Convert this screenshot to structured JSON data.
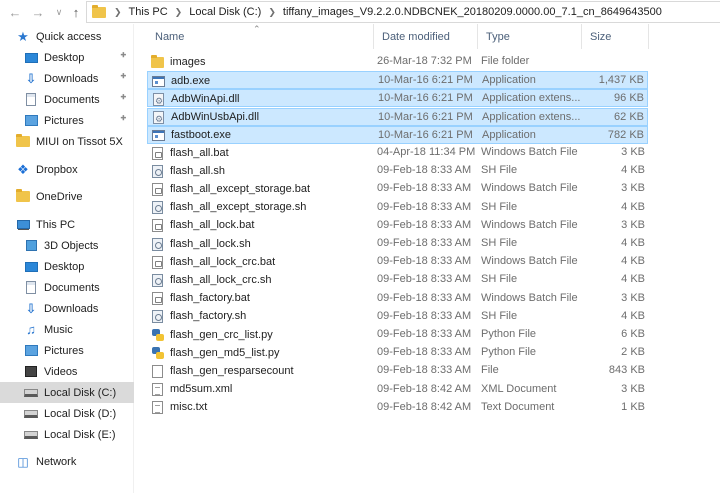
{
  "address": {
    "crumbs": [
      "This PC",
      "Local Disk (C:)",
      "tiffany_images_V9.2.2.0.NDBCNEK_20180209.0000.00_7.1_cn_8649643500"
    ]
  },
  "sidebar": {
    "items": [
      {
        "label": "Quick access",
        "icon": "star-icon",
        "pinned": false
      },
      {
        "label": "Desktop",
        "icon": "desktop-icon",
        "pinned": true
      },
      {
        "label": "Downloads",
        "icon": "download-icon",
        "pinned": true
      },
      {
        "label": "Documents",
        "icon": "documents-icon",
        "pinned": true
      },
      {
        "label": "Pictures",
        "icon": "pictures-icon",
        "pinned": true
      },
      {
        "label": "MIUI on Tissot 5X",
        "icon": "folder-icon",
        "pinned": false
      },
      {
        "label": "Dropbox",
        "icon": "dropbox-icon",
        "pinned": false
      },
      {
        "label": "OneDrive",
        "icon": "folder-icon",
        "pinned": false
      },
      {
        "label": "This PC",
        "icon": "pc-icon",
        "pinned": false
      },
      {
        "label": "3D Objects",
        "icon": "cube-icon",
        "pinned": false
      },
      {
        "label": "Desktop",
        "icon": "desktop-icon",
        "pinned": false
      },
      {
        "label": "Documents",
        "icon": "documents-icon",
        "pinned": false
      },
      {
        "label": "Downloads",
        "icon": "download-icon",
        "pinned": false
      },
      {
        "label": "Music",
        "icon": "music-icon",
        "pinned": false
      },
      {
        "label": "Pictures",
        "icon": "pictures-icon",
        "pinned": false
      },
      {
        "label": "Videos",
        "icon": "videos-icon",
        "pinned": false
      },
      {
        "label": "Local Disk (C:)",
        "icon": "drive-icon",
        "pinned": false,
        "selected": true
      },
      {
        "label": "Local Disk (D:)",
        "icon": "drive-icon",
        "pinned": false
      },
      {
        "label": "Local Disk (E:)",
        "icon": "drive-icon",
        "pinned": false
      },
      {
        "label": "Network",
        "icon": "network-icon",
        "pinned": false
      }
    ]
  },
  "columns": {
    "name": "Name",
    "date": "Date modified",
    "type": "Type",
    "size": "Size"
  },
  "files": [
    {
      "name": "images",
      "date": "26-Mar-18 7:32 PM",
      "type": "File folder",
      "size": "",
      "icon": "folder-icon",
      "selected": false
    },
    {
      "name": "adb.exe",
      "date": "10-Mar-16 6:21 PM",
      "type": "Application",
      "size": "1,437 KB",
      "icon": "exe-icon",
      "selected": true
    },
    {
      "name": "AdbWinApi.dll",
      "date": "10-Mar-16 6:21 PM",
      "type": "Application extens...",
      "size": "96 KB",
      "icon": "dll-icon",
      "selected": true
    },
    {
      "name": "AdbWinUsbApi.dll",
      "date": "10-Mar-16 6:21 PM",
      "type": "Application extens...",
      "size": "62 KB",
      "icon": "dll-icon",
      "selected": true
    },
    {
      "name": "fastboot.exe",
      "date": "10-Mar-16 6:21 PM",
      "type": "Application",
      "size": "782 KB",
      "icon": "exe-icon",
      "selected": true
    },
    {
      "name": "flash_all.bat",
      "date": "04-Apr-18 11:34 PM",
      "type": "Windows Batch File",
      "size": "3 KB",
      "icon": "bat-icon",
      "selected": false
    },
    {
      "name": "flash_all.sh",
      "date": "09-Feb-18 8:33 AM",
      "type": "SH File",
      "size": "4 KB",
      "icon": "sh-icon",
      "selected": false
    },
    {
      "name": "flash_all_except_storage.bat",
      "date": "09-Feb-18 8:33 AM",
      "type": "Windows Batch File",
      "size": "3 KB",
      "icon": "bat-icon",
      "selected": false
    },
    {
      "name": "flash_all_except_storage.sh",
      "date": "09-Feb-18 8:33 AM",
      "type": "SH File",
      "size": "4 KB",
      "icon": "sh-icon",
      "selected": false
    },
    {
      "name": "flash_all_lock.bat",
      "date": "09-Feb-18 8:33 AM",
      "type": "Windows Batch File",
      "size": "3 KB",
      "icon": "bat-icon",
      "selected": false
    },
    {
      "name": "flash_all_lock.sh",
      "date": "09-Feb-18 8:33 AM",
      "type": "SH File",
      "size": "4 KB",
      "icon": "sh-icon",
      "selected": false
    },
    {
      "name": "flash_all_lock_crc.bat",
      "date": "09-Feb-18 8:33 AM",
      "type": "Windows Batch File",
      "size": "4 KB",
      "icon": "bat-icon",
      "selected": false
    },
    {
      "name": "flash_all_lock_crc.sh",
      "date": "09-Feb-18 8:33 AM",
      "type": "SH File",
      "size": "4 KB",
      "icon": "sh-icon",
      "selected": false
    },
    {
      "name": "flash_factory.bat",
      "date": "09-Feb-18 8:33 AM",
      "type": "Windows Batch File",
      "size": "3 KB",
      "icon": "bat-icon",
      "selected": false
    },
    {
      "name": "flash_factory.sh",
      "date": "09-Feb-18 8:33 AM",
      "type": "SH File",
      "size": "4 KB",
      "icon": "sh-icon",
      "selected": false
    },
    {
      "name": "flash_gen_crc_list.py",
      "date": "09-Feb-18 8:33 AM",
      "type": "Python File",
      "size": "6 KB",
      "icon": "python-icon",
      "selected": false
    },
    {
      "name": "flash_gen_md5_list.py",
      "date": "09-Feb-18 8:33 AM",
      "type": "Python File",
      "size": "2 KB",
      "icon": "python-icon",
      "selected": false
    },
    {
      "name": "flash_gen_resparsecount",
      "date": "09-Feb-18 8:33 AM",
      "type": "File",
      "size": "843 KB",
      "icon": "file-icon",
      "selected": false
    },
    {
      "name": "md5sum.xml",
      "date": "09-Feb-18 8:42 AM",
      "type": "XML Document",
      "size": "3 KB",
      "icon": "xml-icon",
      "selected": false
    },
    {
      "name": "misc.txt",
      "date": "09-Feb-18 8:42 AM",
      "type": "Text Document",
      "size": "1 KB",
      "icon": "text-icon",
      "selected": false
    }
  ]
}
